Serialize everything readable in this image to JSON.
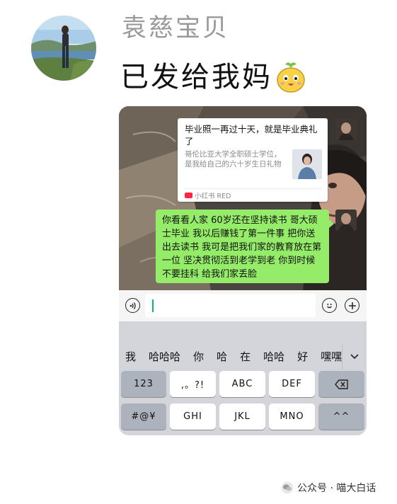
{
  "post": {
    "username": "袁慈宝贝",
    "text": "已发给我妈",
    "emoji": "cute-fruit-face-emoji"
  },
  "chat": {
    "share_card": {
      "title": "毕业照一再过十天，就是毕业典礼了",
      "description": "哥伦比亚大学全职硕士学位，是我给自己的六十岁生日礼物",
      "source": "小红书 RED"
    },
    "message": "你看看人家 60岁还在坚持读书 哥大硕士毕业 我以后赚钱了第一件事 把你送出去读书 我可是把我们家的教育放在第一位 坚决贯彻活到老学到老 你到时候不要挂科 给我们家丢脸"
  },
  "input_bar": {
    "voice_icon": "voice-icon",
    "emoji_icon": "emoji-icon",
    "plus_icon": "plus-icon"
  },
  "keyboard": {
    "candidates": [
      "我",
      "哈哈哈",
      "你",
      "哈",
      "在",
      "哈哈",
      "好",
      "嘿嘿"
    ],
    "row1": {
      "k1": "123",
      "k2": ",。?!",
      "k3": "ABC",
      "k4": "DEF",
      "k5": "delete"
    },
    "row2": {
      "k1": "#@¥",
      "k2": "GHI",
      "k3": "JKL",
      "k4": "MNO",
      "k5": "^^"
    }
  },
  "watermark": {
    "text": "公众号 · 喵大白话"
  },
  "colors": {
    "username": "#9a9a9a",
    "bubble": "#95ec69",
    "caret": "#07c160"
  }
}
